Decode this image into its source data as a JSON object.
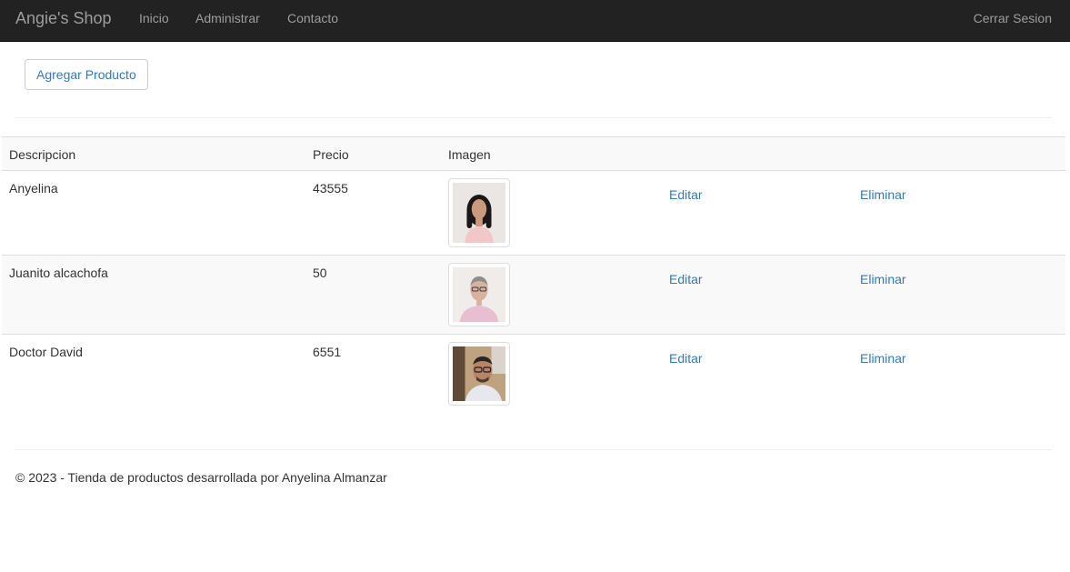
{
  "navbar": {
    "brand": "Angie's Shop",
    "links": [
      "Inicio",
      "Administrar",
      "Contacto"
    ],
    "logout": "Cerrar Sesion"
  },
  "actions": {
    "add_product": "Agregar Producto"
  },
  "table": {
    "headers": [
      "Descripcion",
      "Precio",
      "Imagen"
    ],
    "rows": [
      {
        "description": "Anyelina",
        "price": "43555",
        "edit": "Editar",
        "delete": "Eliminar"
      },
      {
        "description": "Juanito alcachofa",
        "price": "50",
        "edit": "Editar",
        "delete": "Eliminar"
      },
      {
        "description": "Doctor David",
        "price": "6551",
        "edit": "Editar",
        "delete": "Eliminar"
      }
    ]
  },
  "footer": {
    "text": "© 2023 - Tienda de productos desarrollada por Anyelina Almanzar"
  },
  "colors": {
    "navbar_bg": "#222222",
    "navbar_text": "#9d9d9d",
    "link": "#337ab7",
    "stripe": "#f9f9f9",
    "border": "#dddddd"
  }
}
